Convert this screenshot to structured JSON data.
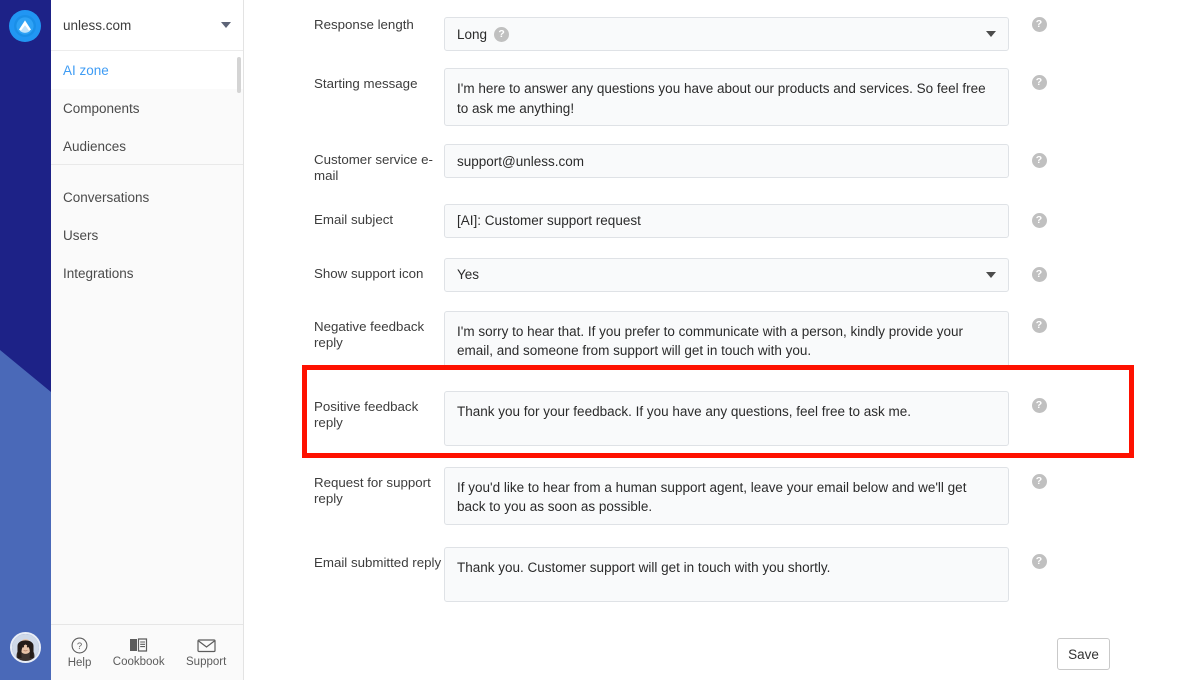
{
  "rail": {
    "logo_icon": "unless-logo-icon",
    "avatar_alt": "user-avatar"
  },
  "sidebar": {
    "site": {
      "name": "unless.com",
      "caret_icon": "chevron-down-icon"
    },
    "group_primary": [
      {
        "label": "AI zone",
        "active": true
      },
      {
        "label": "Components",
        "active": false
      },
      {
        "label": "Audiences",
        "active": false
      }
    ],
    "group_secondary": [
      {
        "label": "Conversations",
        "active": false
      },
      {
        "label": "Users",
        "active": false
      },
      {
        "label": "Integrations",
        "active": false
      }
    ],
    "footer": [
      {
        "label": "Help",
        "icon": "question-circle-icon"
      },
      {
        "label": "Cookbook",
        "icon": "book-icon"
      },
      {
        "label": "Support",
        "icon": "envelope-icon"
      }
    ]
  },
  "form": {
    "help_glyph": "?",
    "rows": [
      {
        "label": "Response length",
        "type": "select",
        "value": "Long",
        "inline_help": true,
        "caret_icon": "chevron-down-icon"
      },
      {
        "label": "Starting message",
        "type": "textarea",
        "value": "I'm here to answer any questions you have about our products and services. So feel free to ask me anything!"
      },
      {
        "label": "Customer service e-mail",
        "type": "input",
        "value": "support@unless.com"
      },
      {
        "label": "Email subject",
        "type": "input",
        "value": "[AI]: Customer support request"
      },
      {
        "label": "Show support icon",
        "type": "select",
        "value": "Yes",
        "inline_help": false,
        "caret_icon": "chevron-down-icon"
      },
      {
        "label": "Negative feedback reply",
        "type": "textarea",
        "value": "I'm sorry to hear that. If you prefer to communicate with a person, kindly provide your email, and someone from support will get in touch with you."
      },
      {
        "label": "Positive feedback reply",
        "type": "textarea",
        "value": "Thank you for your feedback. If you have any questions, feel free to ask me.",
        "highlighted": true
      },
      {
        "label": "Request for support reply",
        "type": "textarea",
        "value": "If you'd like to hear from a human support agent, leave your email below and we'll get back to you as soon as possible."
      },
      {
        "label": "Email submitted reply",
        "type": "textarea",
        "value": "Thank you. Customer support will get in touch with you shortly."
      }
    ],
    "save_label": "Save"
  },
  "colors": {
    "rail_top": "#1d2287",
    "rail_bottom": "#4a69b8",
    "accent_blue": "#3f9cf4",
    "highlight_red": "#fe1100",
    "field_bg": "#f9fafb"
  }
}
